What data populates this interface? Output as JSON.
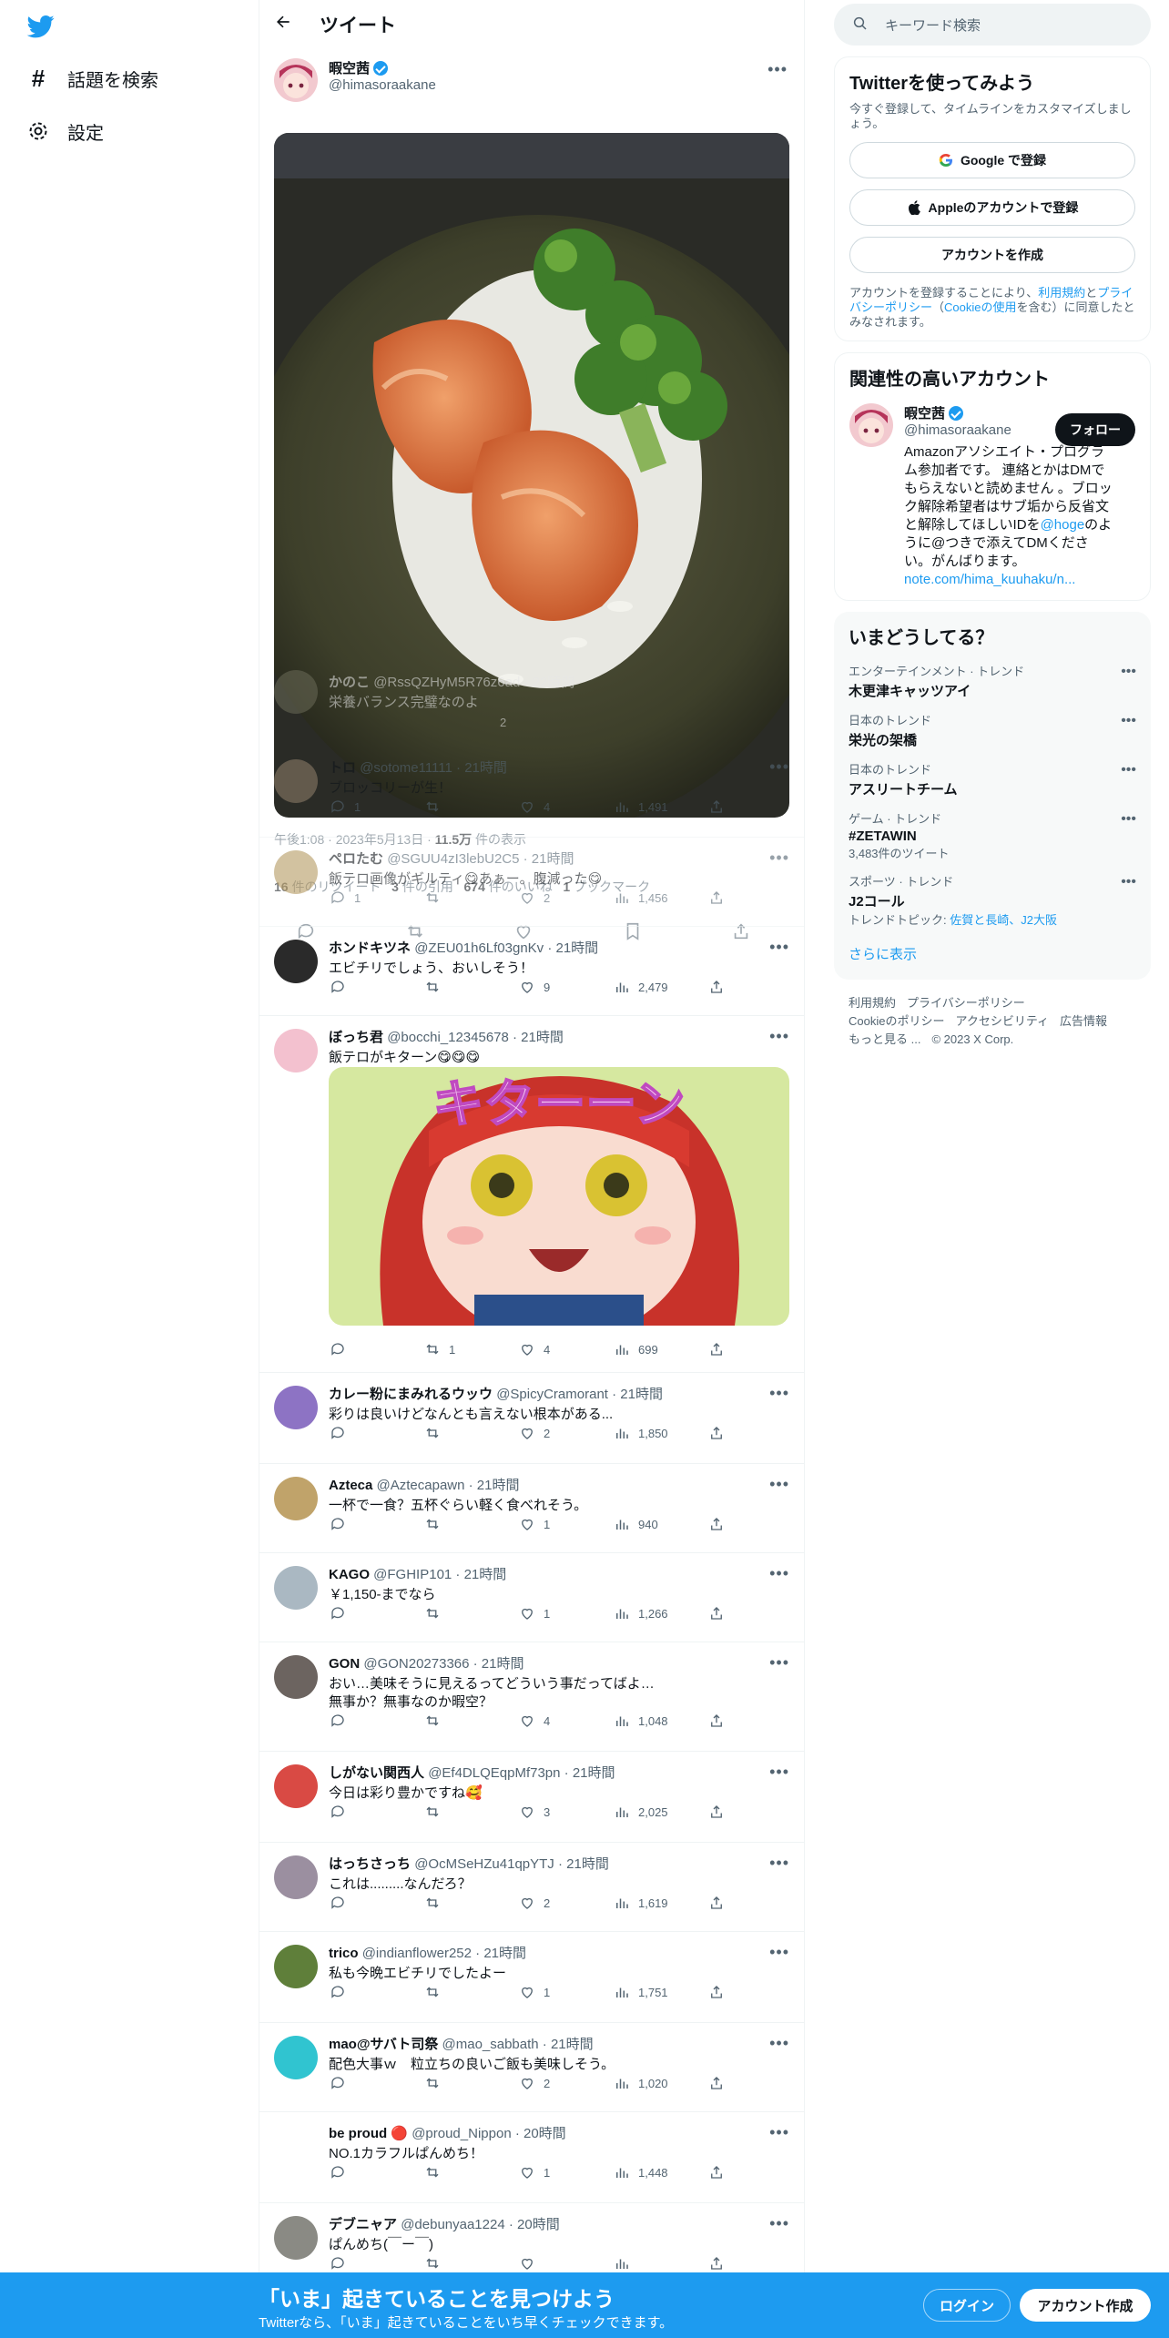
{
  "nav": {
    "explore_label": "話題を検索",
    "settings_label": "設定"
  },
  "header": {
    "title": "ツイート"
  },
  "main_tweet": {
    "name": "暇空茜",
    "handle": "@himasoraakane",
    "timestamp": "午後1:08 · 2023年5月13日 ·",
    "views": "11.5万",
    "views_suffix": "件の表示",
    "retweets": "16",
    "retweets_label": "件のリツイート",
    "quotes": "3",
    "quotes_label": "件の引用",
    "likes": "674",
    "likes_label": "件のいいね",
    "bookmarks": "1",
    "bookmarks_label": "ブックマーク",
    "ghost_reply": {
      "name": "かのこ",
      "handle": "@RssQZHyM5R76z6ad · 22時間",
      "text": "栄養バランス完璧なのよ",
      "likes": "2"
    }
  },
  "replies": [
    {
      "name": "トロ",
      "handle": "@sotome11111 · 21時間",
      "text": "ブロッコリーが生！",
      "replies": "1",
      "retweets": "",
      "likes": "4",
      "views": "1,491"
    },
    {
      "name": "ペロたむ",
      "handle": "@SGUU4zI3lebU2C5 · 21時間",
      "text": "飯テロ画像がギルティ😋あぁー。腹減った😋",
      "replies": "1",
      "retweets": "",
      "likes": "2",
      "views": "1,456"
    },
    {
      "name": "ホンドキツネ",
      "handle": "@ZEU01h6Lf03gnKv · 21時間",
      "text": "エビチリでしょう、おいしそう！",
      "replies": "",
      "retweets": "",
      "likes": "9",
      "views": "2,479"
    },
    {
      "name": "ぼっち君",
      "handle": "@bocchi_12345678 · 21時間",
      "text": "飯テロがキターン😋😋😋",
      "replies": "",
      "retweets": "1",
      "likes": "4",
      "views": "699",
      "image_text": "キターーン"
    },
    {
      "name": "カレー粉にまみれるウッウ",
      "handle": "@SpicyCramorant · 21時間",
      "text": "彩りは良いけどなんとも言えない根本がある...",
      "replies": "",
      "retweets": "",
      "likes": "2",
      "views": "1,850"
    },
    {
      "name": "Azteca",
      "handle": "@Aztecapawn · 21時間",
      "text": "一杯で一食？五杯ぐらい軽く食べれそう。",
      "replies": "",
      "retweets": "",
      "likes": "1",
      "views": "940"
    },
    {
      "name": "KAGO",
      "handle": "@FGHIP101 · 21時間",
      "text": "￥1,150-までなら",
      "replies": "",
      "retweets": "",
      "likes": "1",
      "views": "1,266"
    },
    {
      "name": "GON",
      "handle": "@GON20273366 · 21時間",
      "text": "おい…美味そうに見えるってどういう事だってばよ…",
      "text2": "無事か？無事なのか暇空？",
      "replies": "",
      "retweets": "",
      "likes": "4",
      "views": "1,048"
    },
    {
      "name": "しがない関西人",
      "handle": "@Ef4DLQEqpMf73pn · 21時間",
      "text": "今日は彩り豊かですね🥰",
      "replies": "",
      "retweets": "",
      "likes": "3",
      "views": "2,025"
    },
    {
      "name": "はっちさっち",
      "handle": "@OcMSeHZu41qpYTJ · 21時間",
      "text": "これは.........なんだろ？",
      "replies": "",
      "retweets": "",
      "likes": "2",
      "views": "1,619"
    },
    {
      "name": "trico",
      "handle": "@indianflower252 · 21時間",
      "text": "私も今晩エビチリでしたよー",
      "replies": "",
      "retweets": "",
      "likes": "1",
      "views": "1,751"
    },
    {
      "name": "mao@サバト司祭",
      "handle": "@mao_sabbath · 21時間",
      "text": "配色大事ｗ　粒立ちの良いご飯も美味しそう。",
      "replies": "",
      "retweets": "",
      "likes": "2",
      "views": "1,020"
    },
    {
      "name": "be proud 🔴",
      "handle": "@proud_Nippon · 20時間",
      "text": "NO.1カラフルぱんめち！",
      "replies": "",
      "retweets": "",
      "likes": "1",
      "views": "1,448"
    },
    {
      "name": "デブニャア",
      "handle": "@debunyaa1224 · 20時間",
      "text": "ぱんめち(￣ー￣)",
      "replies": "",
      "retweets": "",
      "likes": "",
      "views": ""
    }
  ],
  "search": {
    "placeholder": "キーワード検索"
  },
  "signup_card": {
    "title": "Twitterを使ってみよう",
    "desc": "今すぐ登録して、タイムラインをカスタマイズしましょう。",
    "google_label": "Google で登録",
    "apple_label": "Appleのアカウントで登録",
    "create_label": "アカウントを作成",
    "terms_prefix": "アカウントを登録することにより、",
    "terms_link": "利用規約",
    "terms_and": "と",
    "privacy_link": "プライバシーポリシー",
    "cookie_open": "（",
    "cookie_link": "Cookieの使用",
    "cookie_close": "を含む）に同意したとみなされます。"
  },
  "relevant_card": {
    "title": "関連性の高いアカウント",
    "name": "暇空茜",
    "handle": "@himasoraakane",
    "follow_label": "フォロー",
    "bio": "Amazonアソシエイト・プログラム参加者です。 連絡とかはDMでもらえないと読めません 。ブロック解除希望者はサブ垢から反省文と解除してほしいIDを",
    "bio_link": "@hoge",
    "bio2": "のように@つきで添えてDMください。がんばります。",
    "bio_url": "note.com/hima_kuuhaku/n..."
  },
  "trends_card": {
    "title": "いまどうしてる？",
    "items": [
      {
        "category": "エンターテインメント · トレンド",
        "name": "木更津キャッツアイ",
        "meta": ""
      },
      {
        "category": "日本のトレンド",
        "name": "栄光の架橋",
        "meta": ""
      },
      {
        "category": "日本のトレンド",
        "name": "アスリートチーム",
        "meta": ""
      },
      {
        "category": "ゲーム · トレンド",
        "name": "#ZETAWIN",
        "meta": "3,483件のツイート"
      },
      {
        "category": "スポーツ · トレンド",
        "name": "J2コール",
        "meta_prefix": "トレンドトピック: ",
        "meta_link": "佐賀と長崎、J2大阪"
      }
    ],
    "show_more": "さらに表示"
  },
  "footer": {
    "line1a": "利用規約",
    "line1b": "プライバシーポリシー",
    "line2a": "Cookieのポリシー",
    "line2b": "アクセシビリティ",
    "line2c": "広告情報",
    "line3a": "もっと見る ...",
    "line3b": "© 2023 X Corp."
  },
  "bottom_bar": {
    "title": "「いま」起きていることを見つけよう",
    "subtitle": "Twitterなら、「いま」起きていることをいち早くチェックできます。",
    "login_label": "ログイン",
    "signup_label": "アカウント作成"
  }
}
